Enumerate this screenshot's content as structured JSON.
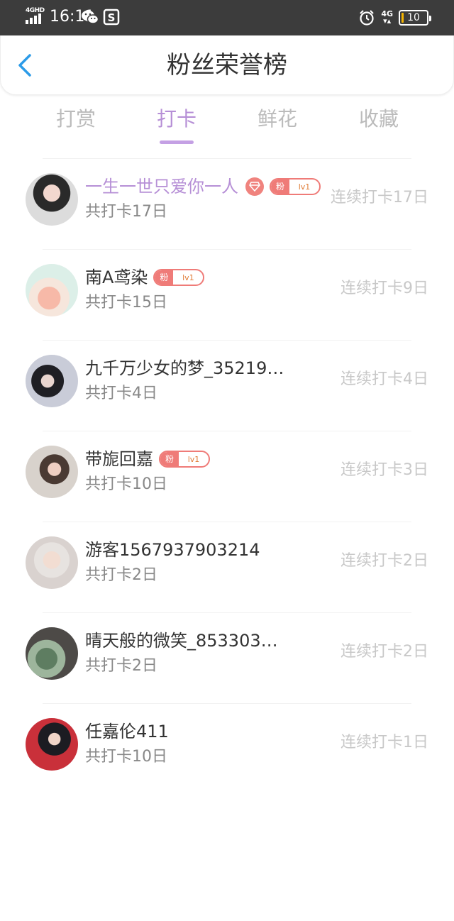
{
  "status_bar": {
    "network_label": "4GHD",
    "time": "16:11",
    "net_type": "4G",
    "battery": "10",
    "battery_level": 0.1
  },
  "header": {
    "title": "粉丝荣誉榜"
  },
  "tabs": [
    {
      "label": "打赏"
    },
    {
      "label": "打卡"
    },
    {
      "label": "鲜花"
    },
    {
      "label": "收藏"
    }
  ],
  "active_tab": "打卡",
  "fans": [
    {
      "name": "一生一世只爱你一人",
      "total": "共打卡17日",
      "streak": "连续打卡17日",
      "badge": "粉",
      "level": "lv1"
    },
    {
      "name": "南A鸢染",
      "total": "共打卡15日",
      "streak": "连续打卡9日",
      "badge": "粉",
      "level": "lv1"
    },
    {
      "name": "九千万少女的梦_35219…",
      "total": "共打卡4日",
      "streak": "连续打卡4日"
    },
    {
      "name": "带旎回嘉",
      "total": "共打卡10日",
      "streak": "连续打卡3日",
      "badge": "粉",
      "level": "lv1"
    },
    {
      "name": "游客1567937903214",
      "total": "共打卡2日",
      "streak": "连续打卡2日"
    },
    {
      "name": "晴天般的微笑_853303…",
      "total": "共打卡2日",
      "streak": "连续打卡2日"
    },
    {
      "name": "任嘉伦411",
      "total": "共打卡10日",
      "streak": "连续打卡1日"
    }
  ],
  "colors": {
    "accent": "#b68fd6",
    "badge": "#ef7b78",
    "status_bar": "#3c3c3c",
    "back_arrow": "#2b9be8"
  },
  "icons": [
    "signal-icon",
    "wechat-icon",
    "sogou-icon",
    "alarm-icon",
    "battery-icon",
    "back-arrow-icon",
    "diamond-icon"
  ]
}
